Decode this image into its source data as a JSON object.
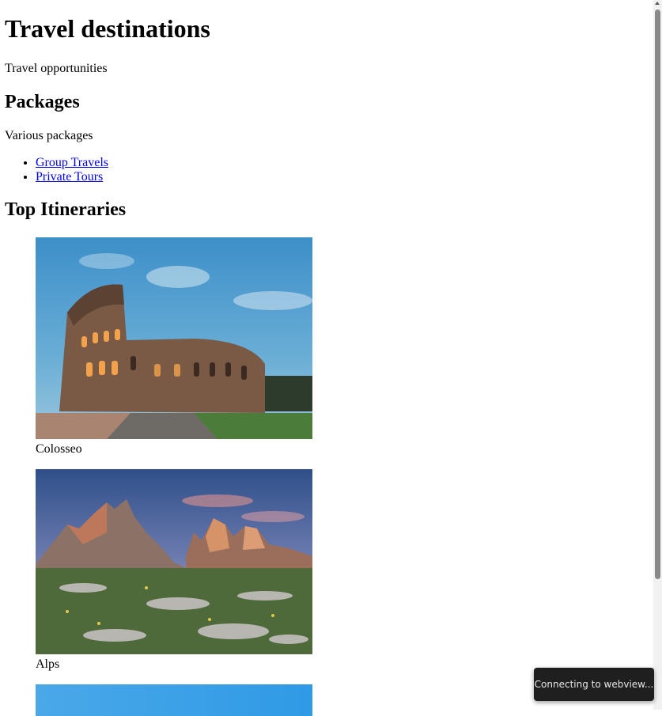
{
  "page": {
    "title": "Travel destinations",
    "subtitle": "Travel opportunities"
  },
  "packages": {
    "heading": "Packages",
    "description": "Various packages",
    "links": [
      "Group Travels",
      "Private Tours"
    ]
  },
  "itineraries": {
    "heading": "Top Itineraries",
    "items": [
      {
        "caption": "Colosseo",
        "image": "colosseum-photo"
      },
      {
        "caption": "Alps",
        "image": "alps-mountains-photo"
      },
      {
        "caption": "",
        "image": "sky-photo-partial"
      }
    ]
  },
  "toast": {
    "text": "Connecting to webview..."
  }
}
